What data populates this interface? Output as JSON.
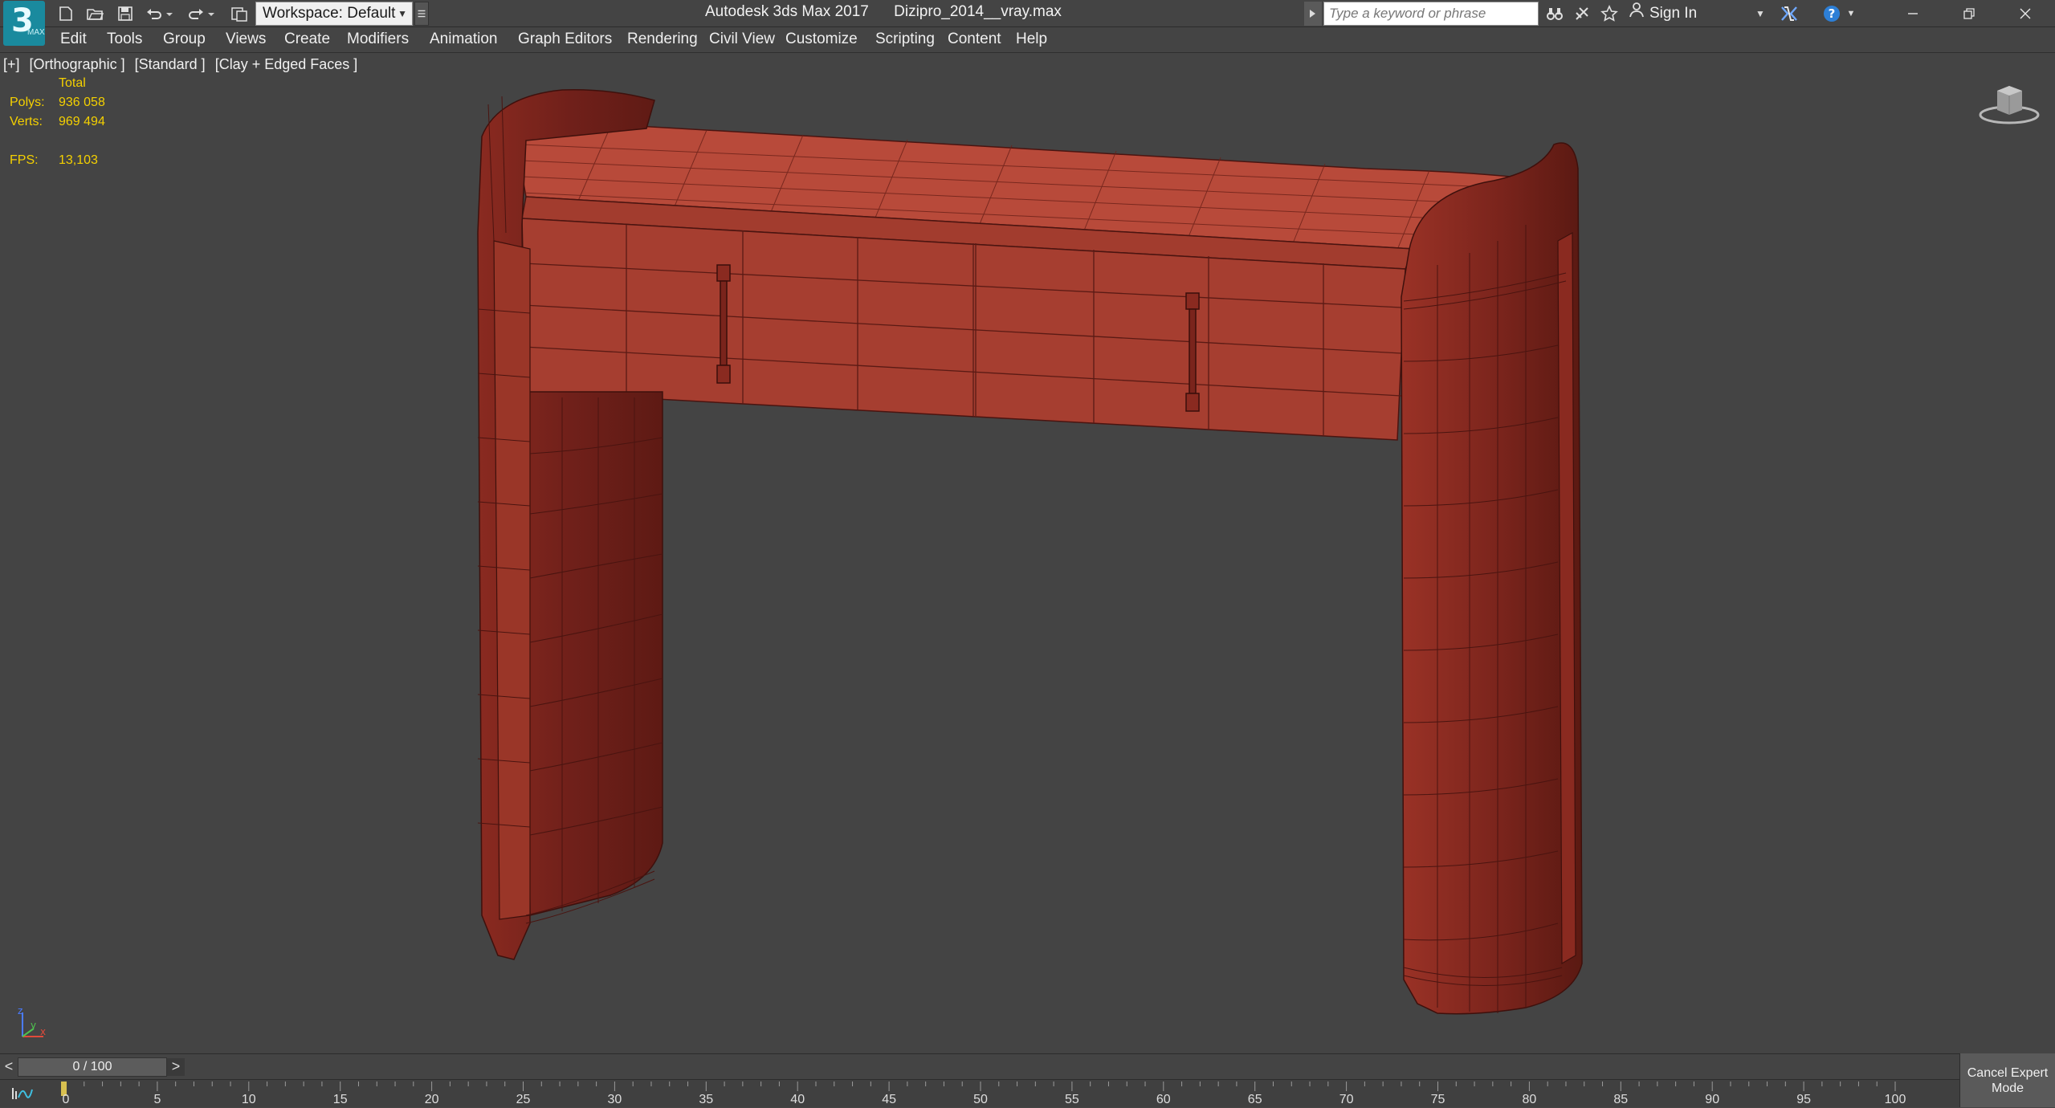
{
  "titlebar": {
    "logo": {
      "text": "3",
      "sub": "MAX"
    },
    "workspace_label": "Workspace: Default",
    "app_name": "Autodesk 3ds Max 2017",
    "file_name": "Dizipro_2014__vray.max",
    "search_placeholder": "Type a keyword or phrase",
    "sign_in": "Sign In"
  },
  "menu": {
    "items": [
      "Edit",
      "Tools",
      "Group",
      "Views",
      "Create",
      "Modifiers",
      "Animation",
      "Graph Editors",
      "Rendering",
      "Civil View",
      "Customize",
      "Scripting",
      "Content",
      "Help"
    ]
  },
  "viewport": {
    "labels": [
      "[+]",
      "[Orthographic ]",
      "[Standard ]",
      "[Clay + Edged Faces ]"
    ],
    "stats": {
      "total_label": "Total",
      "polys_label": "Polys:",
      "polys_value": "936 058",
      "verts_label": "Verts:",
      "verts_value": "969 494",
      "fps_label": "FPS:",
      "fps_value": "13,103"
    },
    "axis_labels": {
      "x": "x",
      "y": "y",
      "z": "z"
    },
    "stats_color": "#f4d000",
    "model_color": "#9b3226"
  },
  "timeline": {
    "prev": "<",
    "next": ">",
    "frame": "0 / 100",
    "ticks": [
      "0",
      "5",
      "10",
      "15",
      "20",
      "25",
      "30",
      "35",
      "40",
      "45",
      "50",
      "55",
      "60",
      "65",
      "70",
      "75",
      "80",
      "85",
      "90",
      "95",
      "100"
    ],
    "cancel_expert": "Cancel Expert Mode"
  }
}
